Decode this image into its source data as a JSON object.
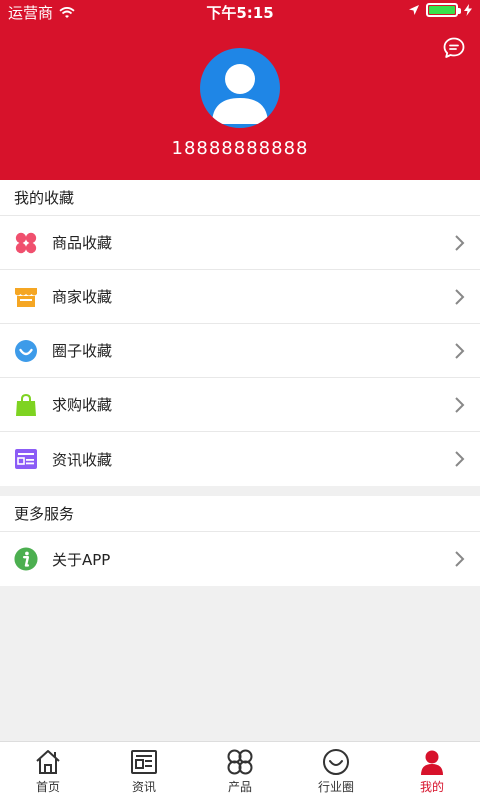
{
  "status_bar": {
    "carrier": "运营商",
    "time": "下午5:15"
  },
  "profile": {
    "phone": "18888888888"
  },
  "favorites": {
    "title": "我的收藏",
    "items": [
      {
        "label": "商品收藏",
        "icon": "clover-icon",
        "color": "#f0506e"
      },
      {
        "label": "商家收藏",
        "icon": "store-icon",
        "color": "#f5a623"
      },
      {
        "label": "圈子收藏",
        "icon": "smile-circle-icon",
        "color": "#3d9be9"
      },
      {
        "label": "求购收藏",
        "icon": "shopping-bag-icon",
        "color": "#7ed321"
      },
      {
        "label": "资讯收藏",
        "icon": "news-card-icon",
        "color": "#8b5cf6"
      }
    ]
  },
  "services": {
    "title": "更多服务",
    "items": [
      {
        "label": "关于APP",
        "icon": "info-icon",
        "color": "#4caf50"
      }
    ]
  },
  "tabbar": {
    "tabs": [
      {
        "label": "首页",
        "icon": "home-icon"
      },
      {
        "label": "资讯",
        "icon": "news-icon"
      },
      {
        "label": "产品",
        "icon": "products-icon"
      },
      {
        "label": "行业圈",
        "icon": "circle-icon"
      },
      {
        "label": "我的",
        "icon": "user-icon",
        "active": true
      }
    ]
  },
  "colors": {
    "brand": "#d7122b",
    "background": "#f0f0f0"
  }
}
